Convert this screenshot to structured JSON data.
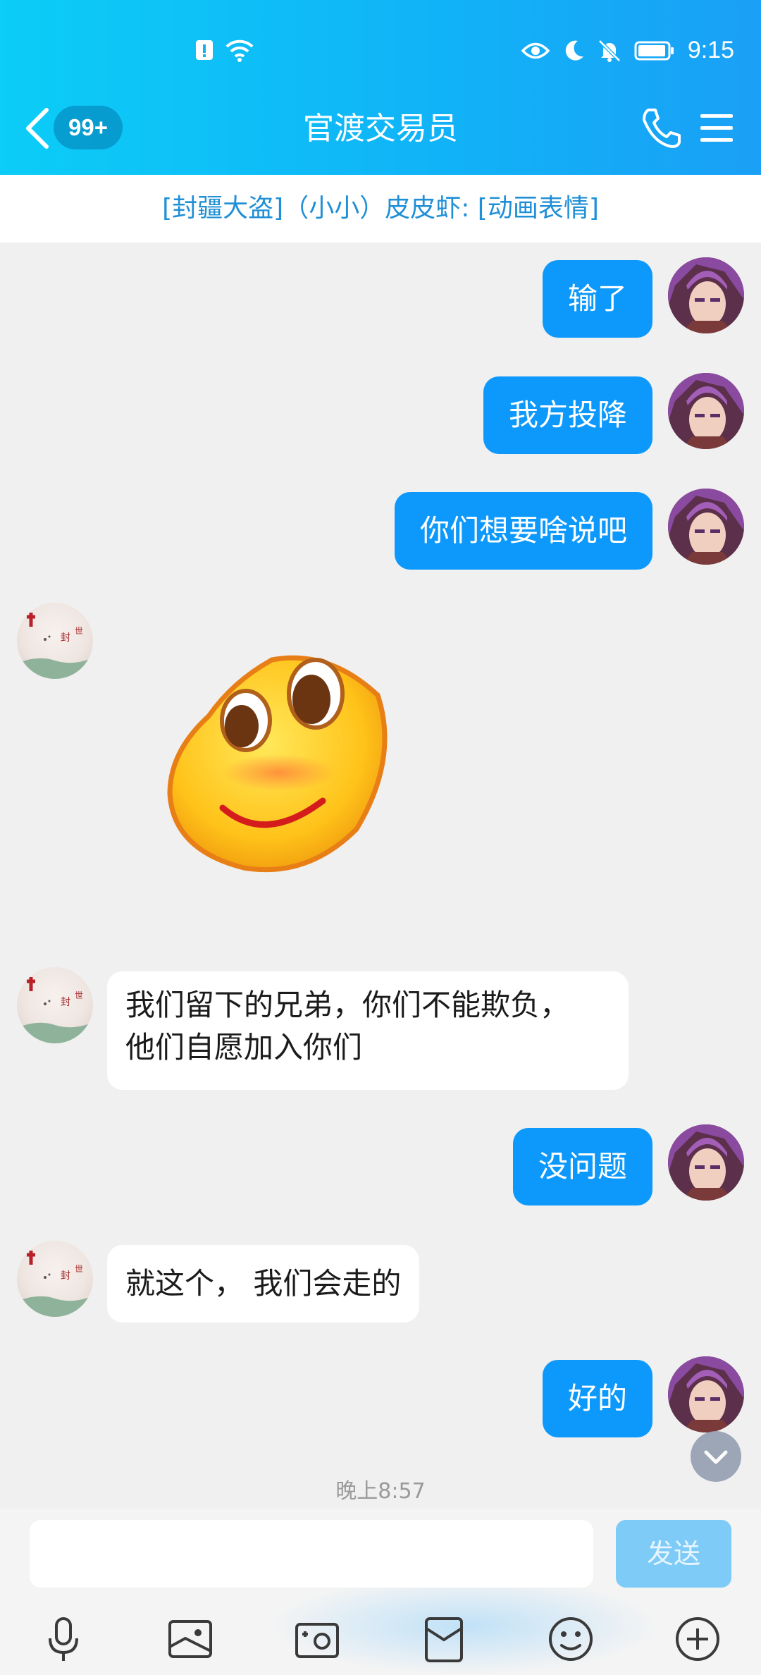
{
  "status_bar": {
    "time": "9:15"
  },
  "header": {
    "unread_badge": "99+",
    "title": "官渡交易员"
  },
  "notice": "[封疆大盗]（小小）皮皮虾: [动画表情]",
  "messages": {
    "m1": "输了",
    "m2": "我方投降",
    "m3": "你们想要啥说吧",
    "m5_line1": "我们留下的兄弟，你们不能欺负，",
    "m5_line2": "他们自愿加入你们",
    "m6": "没问题",
    "m7": "就这个， 我们会走的",
    "m8": "好的"
  },
  "time_divider": "晚上8:57",
  "input": {
    "placeholder": "",
    "send_label": "发送"
  },
  "colors": {
    "header": "#10b4f7",
    "my_bubble": "#0d99fb",
    "notice_text": "#1f8fd6",
    "send_disabled": "#7ecbf8"
  }
}
